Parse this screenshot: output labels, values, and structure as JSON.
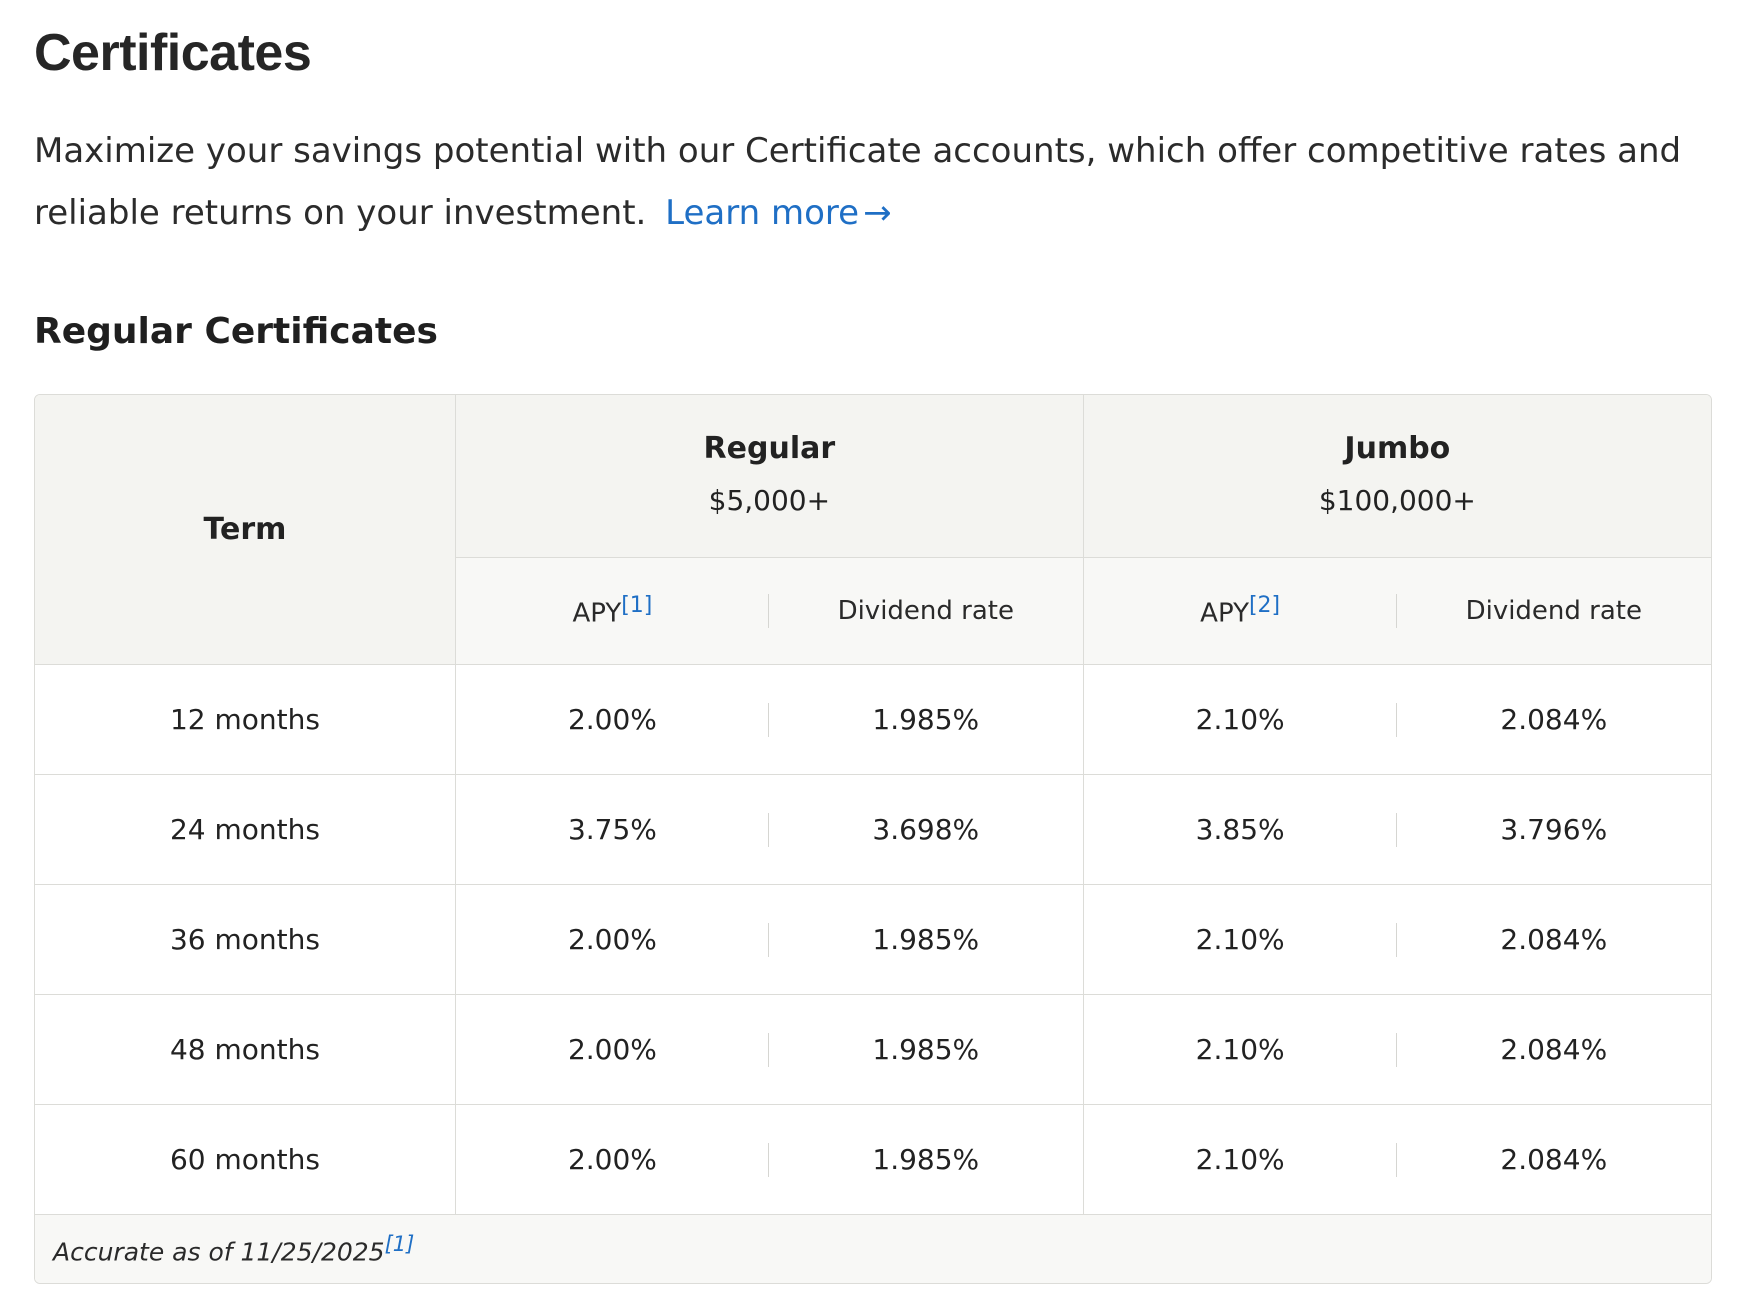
{
  "header": {
    "title": "Certificates",
    "intro": "Maximize your savings potential with our Certificate accounts, which offer competitive rates and reliable returns on your investment.",
    "learn_more": "Learn more",
    "arrow_icon": "arrow-right-icon"
  },
  "section": {
    "title": "Regular Certificates"
  },
  "table": {
    "term_header": "Term",
    "groups": [
      {
        "name": "Regular",
        "minimum": "$5,000+",
        "apy_label": "APY",
        "apy_note": "[1]",
        "dividend_label": "Dividend rate"
      },
      {
        "name": "Jumbo",
        "minimum": "$100,000+",
        "apy_label": "APY",
        "apy_note": "[2]",
        "dividend_label": "Dividend rate"
      }
    ],
    "rows": [
      {
        "term": "12 months",
        "regular_apy": "2.00%",
        "regular_dividend": "1.985%",
        "jumbo_apy": "2.10%",
        "jumbo_dividend": "2.084%"
      },
      {
        "term": "24 months",
        "regular_apy": "3.75%",
        "regular_dividend": "3.698%",
        "jumbo_apy": "3.85%",
        "jumbo_dividend": "3.796%"
      },
      {
        "term": "36 months",
        "regular_apy": "2.00%",
        "regular_dividend": "1.985%",
        "jumbo_apy": "2.10%",
        "jumbo_dividend": "2.084%"
      },
      {
        "term": "48 months",
        "regular_apy": "2.00%",
        "regular_dividend": "1.985%",
        "jumbo_apy": "2.10%",
        "jumbo_dividend": "2.084%"
      },
      {
        "term": "60 months",
        "regular_apy": "2.00%",
        "regular_dividend": "1.985%",
        "jumbo_apy": "2.10%",
        "jumbo_dividend": "2.084%"
      }
    ],
    "footnote": "Accurate as of 11/25/2025",
    "footnote_ref": "[1]"
  },
  "colors": {
    "link": "#1f6fc5",
    "header_bg": "#f4f4f1",
    "border": "#dcdcd8"
  }
}
